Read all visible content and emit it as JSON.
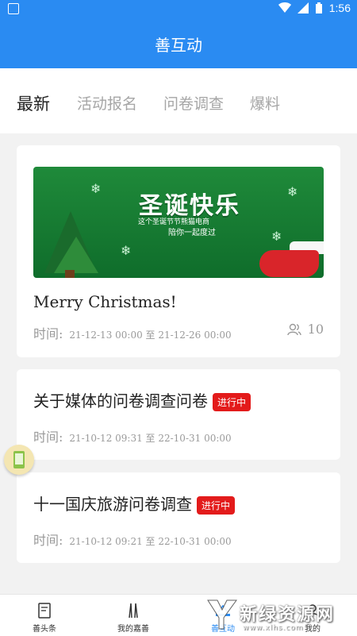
{
  "status": {
    "time": "1:56"
  },
  "appbar": {
    "title": "善互动"
  },
  "tabs": [
    {
      "label": "最新"
    },
    {
      "label": "活动报名"
    },
    {
      "label": "问卷调查"
    },
    {
      "label": "爆料"
    }
  ],
  "cards": [
    {
      "banner": {
        "title": "圣诞快乐",
        "sub1": "这个圣诞节节熊猫电商",
        "sub2": "陪你一起度过"
      },
      "title": "Merry Christmas!",
      "time_label": "时间:",
      "time_range": "21-12-13 00:00 至 21-12-26 00:00",
      "participants": "10"
    },
    {
      "title": "关于媒体的问卷调查问卷",
      "status": "进行中",
      "time_label": "时间:",
      "time_range": "21-10-12 09:31 至 22-10-31 00:00"
    },
    {
      "title": "十一国庆旅游问卷调查",
      "status": "进行中",
      "time_label": "时间:",
      "time_range": "21-10-12 09:21 至 22-10-31 00:00"
    }
  ],
  "bottom_nav": [
    {
      "label": "善头条",
      "icon": "document-icon"
    },
    {
      "label": "我的嘉善",
      "icon": "pagoda-icon"
    },
    {
      "label": "善互动",
      "icon": "interaction-icon"
    },
    {
      "label": "我的",
      "icon": "profile-icon"
    }
  ],
  "watermark": {
    "main": "新绿资源网",
    "sub": "www.xlhs.com"
  },
  "colors": {
    "primary": "#2a8bf2",
    "badge": "#e31b1b"
  }
}
